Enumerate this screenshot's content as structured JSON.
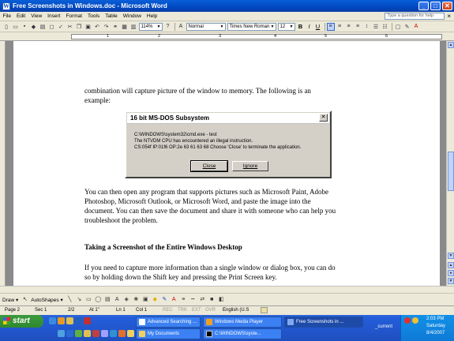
{
  "window": {
    "title": "Free Screenshots in Windows.doc - Microsoft Word",
    "app_icon": "W",
    "min": "_",
    "max": "□",
    "close": "✕"
  },
  "menu": {
    "items": [
      "File",
      "Edit",
      "View",
      "Insert",
      "Format",
      "Tools",
      "Table",
      "Window",
      "Help"
    ],
    "ask_placeholder": "Type a question for help",
    "close_doc": "×"
  },
  "toolbar": {
    "zoom": "114%",
    "style": "Normal",
    "font": "Times New Roman",
    "size": "12",
    "bold": "B",
    "italic": "I",
    "underline": "U"
  },
  "ruler": {
    "numbers": [
      "1",
      "2",
      "3",
      "4",
      "5",
      "6"
    ]
  },
  "document": {
    "lines": [
      "combination will capture picture of the window to memory.  The following is an",
      "example:",
      "You can then open any program that supports pictures such as Microsoft Paint, Adobe",
      "Photoshop, Microsoft Outlook, or Microsoft Word, and paste the image into the",
      "document.  You can then save the document and share it with someone who can help you",
      "troubleshoot the problem.",
      "Taking a Screenshot of the Entire Windows Desktop",
      "If you need to capture more information than a single window or dialog box, you can do",
      "so by holding down the Shift key and pressing the Print Screen key."
    ]
  },
  "dialog": {
    "title": "16 bit MS-DOS Subsystem",
    "lines": [
      "C:\\WINDOWS\\system32\\cmd.exe - test",
      "The NTVDM CPU has encountered an illegal instruction.",
      "CS:054f IP:01f6 OP:2e 63 61 63 68 Choose 'Close' to terminate the application."
    ],
    "close_label": "Close",
    "ignore_label": "Ignore"
  },
  "drawbar": {
    "draw": "Draw ▾",
    "autoshapes": "AutoShapes ▾"
  },
  "status": {
    "page": "Page  2",
    "sec": "Sec  1",
    "pages": "2/2",
    "at": "At  1\"",
    "ln": "Ln  1",
    "col": "Col  1",
    "rec": "REC",
    "trk": "TRK",
    "ext": "EXT",
    "ovr": "OVR",
    "lang": "English (U.S"
  },
  "taskbar": {
    "start": "start",
    "buttons": [
      "Advanced Searching ...",
      "Windows Media Player",
      "Free Screenshots in ...",
      "My Documents",
      "C:\\WINDOWS\\syste..."
    ],
    "tray_label": "_current",
    "time": "2:03 PM",
    "day": "Saturday",
    "date": "8/4/2007"
  }
}
